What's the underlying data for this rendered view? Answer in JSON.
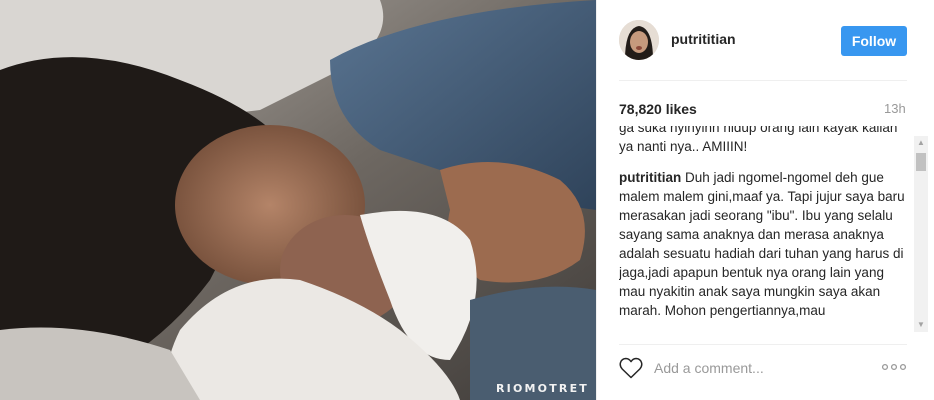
{
  "photo": {
    "watermark": "RIOMOTRET"
  },
  "header": {
    "username": "putrititian",
    "follow_label": "Follow",
    "accent": "#3897f0"
  },
  "stats": {
    "likes": "78,820 likes",
    "time": "13h"
  },
  "comments": {
    "fragment": "ga suka nyinyinn hidup orang lain kayak kalian ya nanti nya.. AMIIIN!",
    "items": [
      {
        "author": "putrititian",
        "text": "Duh jadi ngomel-ngomel deh gue malem malem gini,maaf ya. Tapi jujur saya baru merasakan jadi seorang \"ibu\". Ibu yang selalu sayang sama anaknya dan merasa anaknya adalah sesuatu hadiah dari tuhan yang harus di jaga,jadi apapun bentuk nya orang lain yang mau nyakitin anak saya mungkin saya akan marah. Mohon pengertiannya,mau"
      }
    ]
  },
  "footer": {
    "comment_placeholder": "Add a comment...",
    "like_icon": "heart-icon",
    "more_icon": "more-options-icon"
  }
}
